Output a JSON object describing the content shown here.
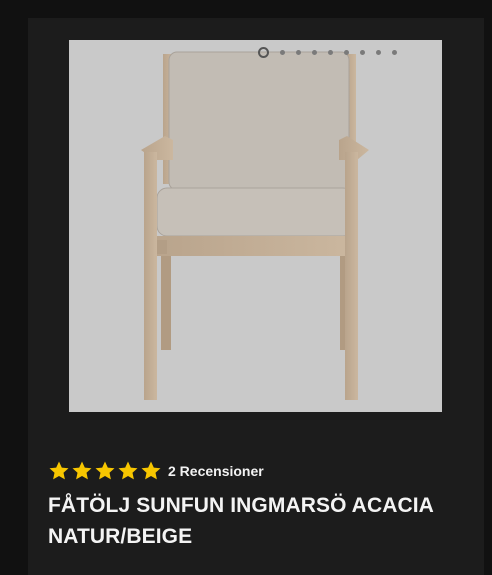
{
  "product": {
    "image_alt": "chair-image",
    "gallery": {
      "total": 9,
      "active_index": 0
    },
    "rating": {
      "stars": 5,
      "max": 5,
      "review_count_label": "2 Recensioner"
    },
    "title_line1": "FÅTÖLJ SUNFUN INGMARSÖ ACACIA",
    "title_line2": "NATUR/BEIGE"
  },
  "colors": {
    "background": "#111111",
    "card": "#1c1c1c",
    "image_bg": "#c9c9c9",
    "star": "#f7c600",
    "text": "#f4f4f4"
  }
}
